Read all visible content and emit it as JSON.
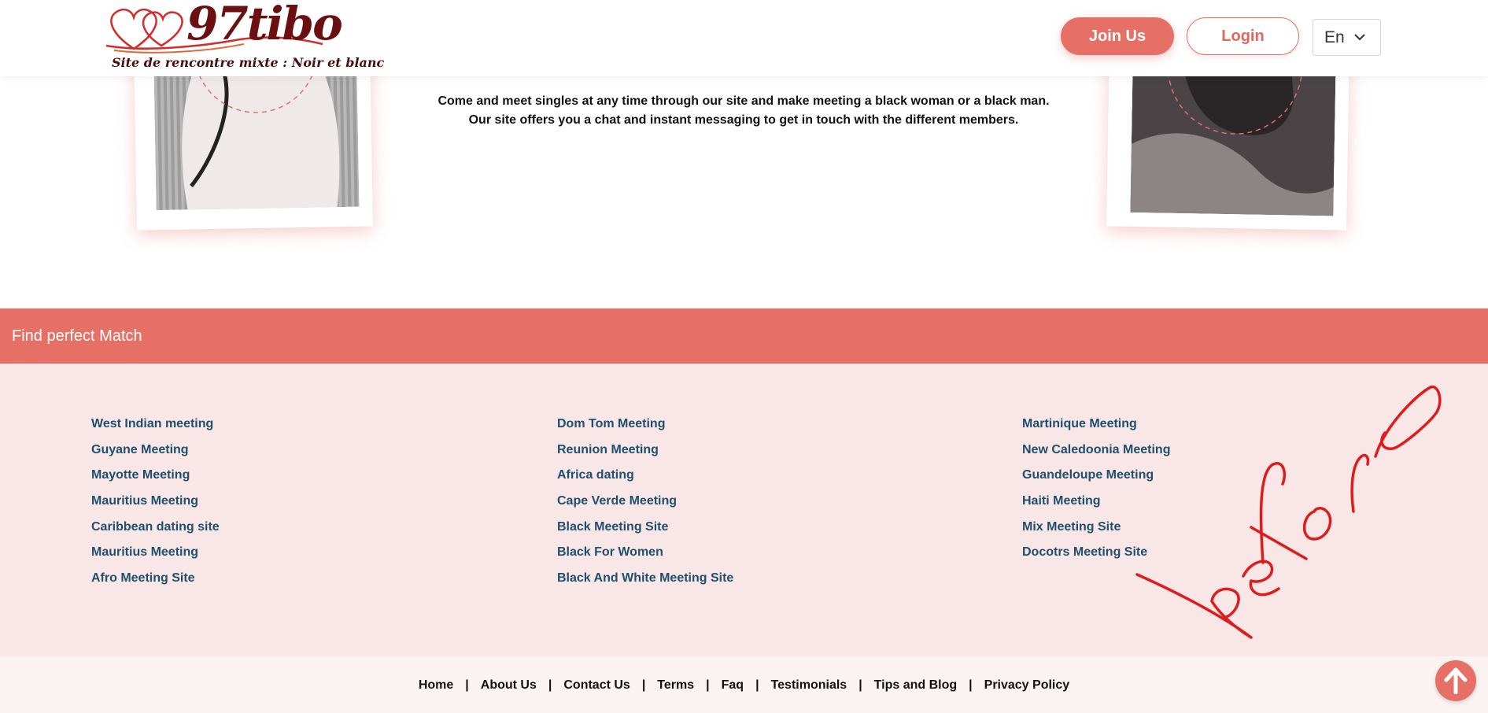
{
  "header": {
    "logo_name": "97tibo",
    "logo_tagline": "Site de rencontre mixte : Noir et blanc",
    "join_label": "Join Us",
    "login_label": "Login",
    "language": "En"
  },
  "intro": {
    "line1": "Come and meet singles at any time through our site and make meeting a black woman or a black man.",
    "line2": "Our site offers you a chat and instant messaging to get in touch with the different members."
  },
  "match": {
    "title": "Find perfect Match",
    "columns": [
      [
        "West Indian meeting",
        "Guyane Meeting",
        "Mayotte Meeting",
        "Mauritius Meeting",
        "Caribbean dating site",
        "Mauritius Meeting",
        "Afro Meeting Site"
      ],
      [
        "Dom Tom Meeting",
        "Reunion Meeting",
        "Africa dating",
        "Cape Verde Meeting",
        "Black Meeting Site",
        "Black For Women",
        "Black And White Meeting Site"
      ],
      [
        "Martinique Meeting",
        "New Caledoonia Meeting",
        "Guandeloupe Meeting",
        "Haiti Meeting",
        "Mix Meeting Site",
        "Docotrs Meeting Site"
      ]
    ]
  },
  "footer": {
    "links": [
      "Home",
      "About Us",
      "Contact Us",
      "Terms",
      "Faq",
      "Testimonials",
      "Tips and Blog",
      "Privacy Policy"
    ]
  },
  "annotation": "before",
  "colors": {
    "accent": "#e67065",
    "link": "#1f4f6e",
    "links_bg": "#f9e6e6",
    "footer_bg": "#fbf2f2",
    "logo": "#6b0f10",
    "annotation": "#e01b1b"
  },
  "icons": {
    "language_dropdown": "chevron-down-icon",
    "scroll_top": "arrow-up-icon"
  }
}
